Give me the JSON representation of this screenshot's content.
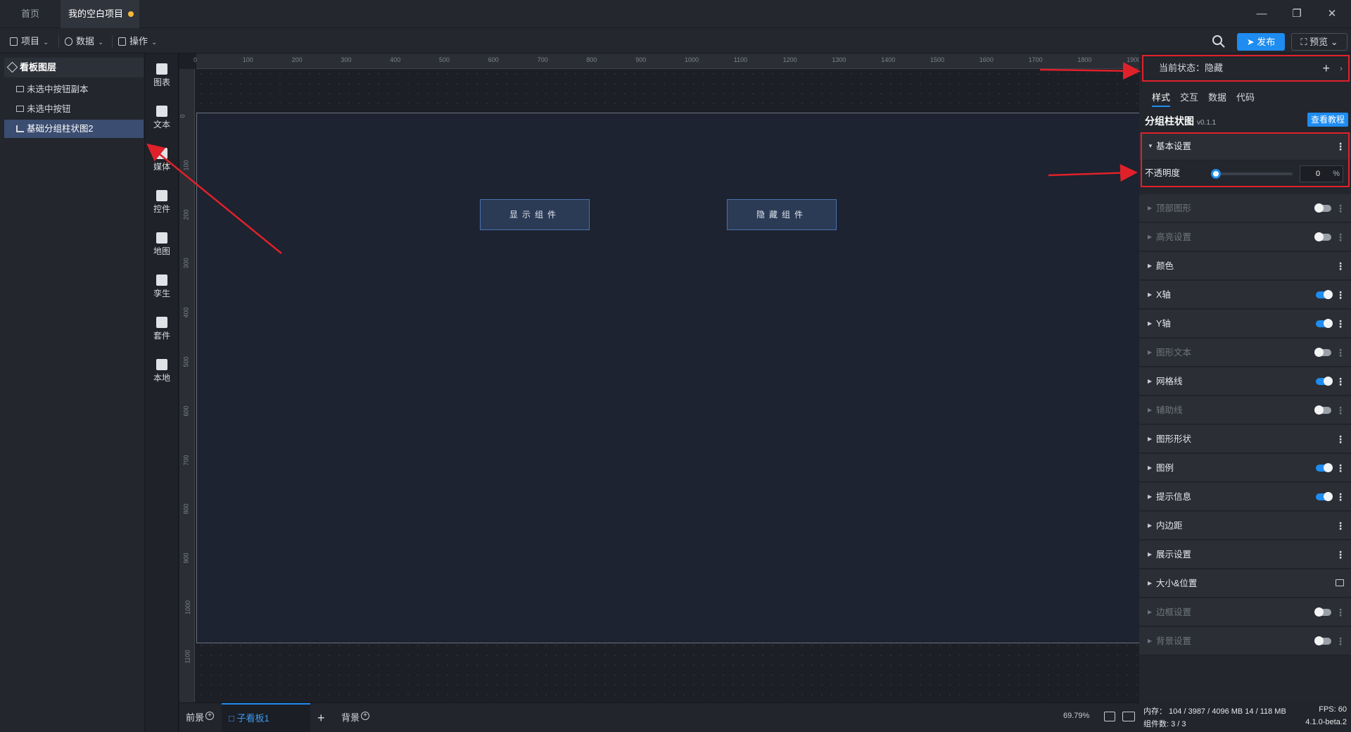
{
  "tabs": {
    "home": "首页",
    "project": "我的空白项目"
  },
  "menu": {
    "project": "项目",
    "data": "数据",
    "ops": "操作"
  },
  "toolbar": {
    "publish": "发布",
    "preview": "预览"
  },
  "layers": {
    "title": "看板图层",
    "items": [
      {
        "label": "未选中按钮副本"
      },
      {
        "label": "未选中按钮"
      },
      {
        "label": "基础分组柱状图2"
      }
    ]
  },
  "components": [
    "图表",
    "文本",
    "媒体",
    "控件",
    "地图",
    "孪生",
    "套件",
    "本地"
  ],
  "ruler": {
    "top": [
      "0",
      "100",
      "200",
      "300",
      "400",
      "500",
      "600",
      "700",
      "800",
      "900",
      "1000",
      "1100",
      "1200",
      "1300",
      "1400",
      "1500",
      "1600",
      "1700",
      "1800",
      "1900"
    ],
    "left": [
      "0",
      "100",
      "200",
      "300",
      "400",
      "500",
      "600",
      "700",
      "800",
      "900",
      "1000",
      "1100"
    ]
  },
  "canvas": {
    "show_btn": "显示组件",
    "hide_btn": "隐藏组件"
  },
  "bottom": {
    "foreground": "前景",
    "sub_board": "子看板1",
    "background": "背景",
    "zoom": "69.79%"
  },
  "props": {
    "state_label": "当前状态：隐藏",
    "tabs": [
      "样式",
      "交互",
      "数据",
      "代码"
    ],
    "component_name": "分组柱状图",
    "version": "v0.1.1",
    "tutorial": "查看教程",
    "basic_settings": "基本设置",
    "opacity_label": "不透明度",
    "opacity_value": "0",
    "opacity_unit": "%",
    "sections": [
      {
        "label": "顶部图形",
        "dim": true,
        "toggle": "off"
      },
      {
        "label": "高亮设置",
        "dim": true,
        "toggle": "off"
      },
      {
        "label": "颜色",
        "dim": false,
        "toggle": "none"
      },
      {
        "label": "X轴",
        "dim": false,
        "toggle": "on"
      },
      {
        "label": "Y轴",
        "dim": false,
        "toggle": "on"
      },
      {
        "label": "图形文本",
        "dim": true,
        "toggle": "off"
      },
      {
        "label": "网格线",
        "dim": false,
        "toggle": "on"
      },
      {
        "label": "辅助线",
        "dim": true,
        "toggle": "off"
      },
      {
        "label": "图形形状",
        "dim": false,
        "toggle": "none"
      },
      {
        "label": "图例",
        "dim": false,
        "toggle": "on"
      },
      {
        "label": "提示信息",
        "dim": false,
        "toggle": "on"
      },
      {
        "label": "内边距",
        "dim": false,
        "toggle": "none"
      },
      {
        "label": "展示设置",
        "dim": false,
        "toggle": "none"
      },
      {
        "label": "大小&位置",
        "dim": false,
        "toggle": "lock"
      },
      {
        "label": "边框设置",
        "dim": true,
        "toggle": "off"
      },
      {
        "label": "背景设置",
        "dim": true,
        "toggle": "off"
      }
    ]
  },
  "status": {
    "memory": "内存： 104 / 3987 / 4096 MB  14 / 118 MB",
    "fps": "FPS:  60",
    "count": "组件数: 3 / 3",
    "version": "4.1.0-beta.2"
  },
  "colors": {
    "accent": "#1e8cf0",
    "highlight_box": "#e0212a",
    "selected_layer": "#3b4d70"
  }
}
